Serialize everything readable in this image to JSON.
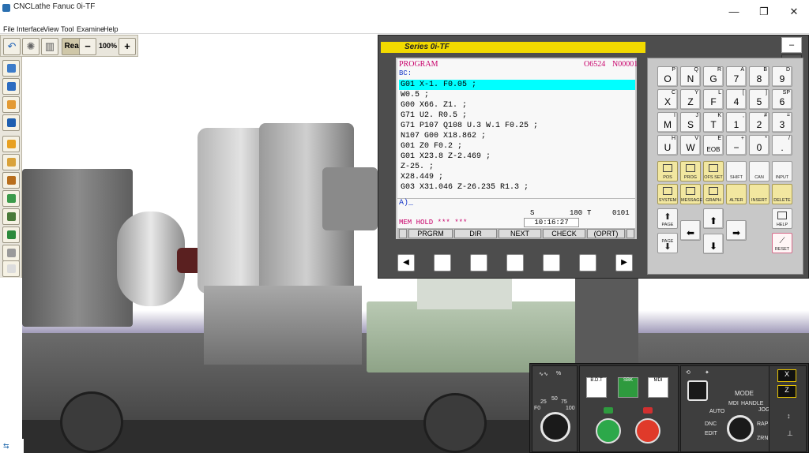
{
  "window": {
    "title": "CNCLathe Fanuc 0i-TF",
    "minimize": "—",
    "maximize": "❐",
    "close": "✕"
  },
  "menu": [
    "File",
    "Interface",
    "View",
    "Tool",
    "Examine",
    "Help"
  ],
  "toolbar": {
    "real_label": "Real",
    "zoom_out": "−",
    "zoom_value": "100%",
    "zoom_in": "+"
  },
  "cnc": {
    "series": "Series 0i-TF",
    "screen": {
      "mode": "PROGRAM",
      "program_no": "O6524",
      "seq_no": "N00001",
      "sub": "BC:",
      "lines": [
        "G01 X-1. F0.05 ;",
        "W0.5 ;",
        "G00 X66. Z1. ;",
        "G71 U2. R0.5 ;",
        "G71 P107 Q108 U.3 W.1 F0.25 ;",
        "N107 G00 X18.862 ;",
        "G01 Z0 F0.2 ;",
        "G01 X23.8 Z-2.469 ;",
        "Z-25. ;",
        "X28.449 ;",
        "G03 X31.046 Z-26.235 R1.3 ;"
      ],
      "input": "A)_",
      "spindle_label": "S",
      "spindle_value": "180",
      "tool_label": "T",
      "tool_value": "0101",
      "status": "MEM   HOLD  ***  ***",
      "time": "10:16:27",
      "softkeys": [
        "PRGRM",
        "DIR",
        "NEXT",
        "CHECK",
        "(OPRT)"
      ]
    },
    "keys": {
      "row1": [
        {
          "k": "O",
          "s": "P"
        },
        {
          "k": "N",
          "s": "Q"
        },
        {
          "k": "G",
          "s": "R"
        },
        {
          "k": "7",
          "s": "A"
        },
        {
          "k": "8",
          "s": "B"
        },
        {
          "k": "9",
          "s": "D"
        }
      ],
      "row2": [
        {
          "k": "X",
          "s": "C"
        },
        {
          "k": "Z",
          "s": "Y"
        },
        {
          "k": "F",
          "s": "L"
        },
        {
          "k": "4",
          "s": "["
        },
        {
          "k": "5",
          "s": "]"
        },
        {
          "k": "6",
          "s": "SP"
        }
      ],
      "row3": [
        {
          "k": "M",
          "s": "I"
        },
        {
          "k": "S",
          "s": "J"
        },
        {
          "k": "T",
          "s": "K"
        },
        {
          "k": "1",
          "s": ","
        },
        {
          "k": "2",
          "s": "#"
        },
        {
          "k": "3",
          "s": "="
        }
      ],
      "row4": [
        {
          "k": "U",
          "s": "H"
        },
        {
          "k": "W",
          "s": "V"
        },
        {
          "k": "EOB",
          "s": "E"
        },
        {
          "k": "−",
          "s": "+"
        },
        {
          "k": "0",
          "s": "*"
        },
        {
          "k": ".",
          "s": "/"
        }
      ],
      "func1": [
        "POS",
        "PROG",
        "OFS SET",
        "SHIFT",
        "CAN",
        "INPUT"
      ],
      "func2": [
        "SYSTEM",
        "MESSAGE",
        "GRAPH",
        "ALTER",
        "INSERT",
        "DELETE"
      ],
      "page_up": "PAGE",
      "page_down": "PAGE",
      "help": "HELP",
      "reset": "RESET"
    }
  },
  "mcp": {
    "feed_label": "%",
    "feed_ticks": [
      "25",
      "50",
      "75",
      "100"
    ],
    "feed_start": "F0",
    "bdt_label": "B.D.T",
    "single_label": "SBK",
    "mdi_label": "MDI",
    "mode_label": "MODE",
    "mode_items": [
      "AUTO",
      "MDI",
      "HANDLE",
      "JOG",
      "EDIT",
      "DNC",
      "RAPID",
      "ZRN"
    ]
  }
}
